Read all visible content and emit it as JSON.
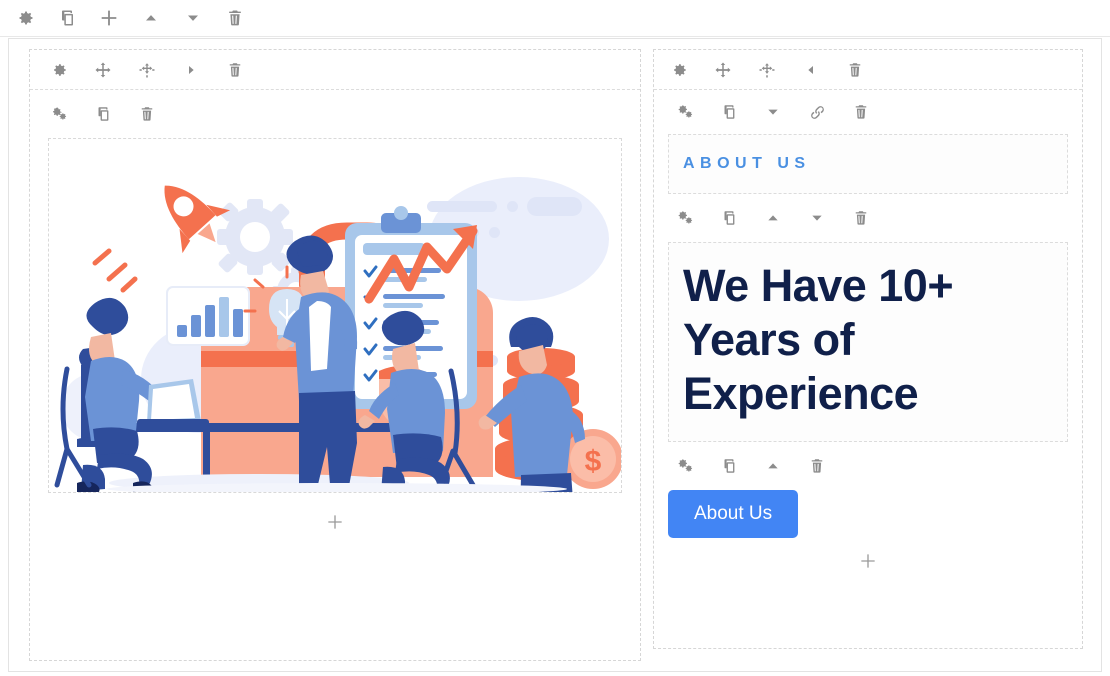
{
  "top_toolbar": {
    "items": [
      {
        "icon": "gear-icon",
        "label": "Settings"
      },
      {
        "icon": "duplicate-icon",
        "label": "Duplicate"
      },
      {
        "icon": "plus-icon",
        "label": "Add"
      },
      {
        "icon": "triangle-up-icon",
        "label": "Move Up"
      },
      {
        "icon": "triangle-down-icon",
        "label": "Move Down"
      },
      {
        "icon": "trash-icon",
        "label": "Delete"
      }
    ]
  },
  "left_column": {
    "toolbar": {
      "items": [
        {
          "icon": "gear-icon",
          "label": "Column Settings"
        },
        {
          "icon": "move-icon",
          "label": "Move Column"
        },
        {
          "icon": "collapse-icon",
          "label": "Resize Column"
        },
        {
          "icon": "triangle-right-icon",
          "label": "Next Column"
        },
        {
          "icon": "trash-icon",
          "label": "Delete Column"
        }
      ]
    },
    "image_widget": {
      "toolbar": {
        "items": [
          {
            "icon": "cogs-icon",
            "label": "Image Settings"
          },
          {
            "icon": "duplicate-icon",
            "label": "Duplicate Image"
          },
          {
            "icon": "trash-icon",
            "label": "Delete Image"
          }
        ]
      },
      "alt": "Business team illustration with briefcase, rocket, clipboard checklist, growth arrow and coins"
    },
    "add_widget": {
      "icon": "plus-icon",
      "label": "Add Widget"
    }
  },
  "right_column": {
    "toolbar": {
      "items": [
        {
          "icon": "gear-icon",
          "label": "Column Settings"
        },
        {
          "icon": "move-icon",
          "label": "Move Column"
        },
        {
          "icon": "collapse-icon",
          "label": "Resize Column"
        },
        {
          "icon": "triangle-left-icon",
          "label": "Previous Column"
        },
        {
          "icon": "trash-icon",
          "label": "Delete Column"
        }
      ]
    },
    "eyebrow_widget": {
      "toolbar": {
        "items": [
          {
            "icon": "cogs-icon",
            "label": "Text Settings"
          },
          {
            "icon": "duplicate-icon",
            "label": "Duplicate Text"
          },
          {
            "icon": "triangle-down-icon",
            "label": "Move Down"
          },
          {
            "icon": "link-icon",
            "label": "Link"
          },
          {
            "icon": "trash-icon",
            "label": "Delete Text"
          }
        ]
      },
      "text": "ABOUT US"
    },
    "heading_widget": {
      "toolbar": {
        "items": [
          {
            "icon": "cogs-icon",
            "label": "Heading Settings"
          },
          {
            "icon": "duplicate-icon",
            "label": "Duplicate Heading"
          },
          {
            "icon": "triangle-up-icon",
            "label": "Move Up"
          },
          {
            "icon": "triangle-down-icon",
            "label": "Move Down"
          },
          {
            "icon": "trash-icon",
            "label": "Delete Heading"
          }
        ]
      },
      "line1": "We Have 10+",
      "line2": "Years of",
      "line3": "Experience"
    },
    "button_widget": {
      "toolbar": {
        "items": [
          {
            "icon": "cogs-icon",
            "label": "Button Settings"
          },
          {
            "icon": "duplicate-icon",
            "label": "Duplicate Button"
          },
          {
            "icon": "triangle-up-icon",
            "label": "Move Up"
          },
          {
            "icon": "trash-icon",
            "label": "Delete Button"
          }
        ]
      },
      "label": "About Us"
    },
    "add_widget": {
      "icon": "plus-icon",
      "label": "Add Widget"
    }
  },
  "colors": {
    "accent_blue": "#4285f4",
    "eyebrow_blue": "#4a90e2",
    "heading_navy": "#10204a",
    "icon_gray": "#8c8c8c",
    "border_dashed": "#d6d6d6",
    "illustration_orange": "#f4714e",
    "illustration_salmon": "#f7a08a",
    "illustration_blue": "#6b93d6",
    "illustration_navy": "#2f4d9b",
    "illustration_lightblue": "#a8c7ea"
  }
}
